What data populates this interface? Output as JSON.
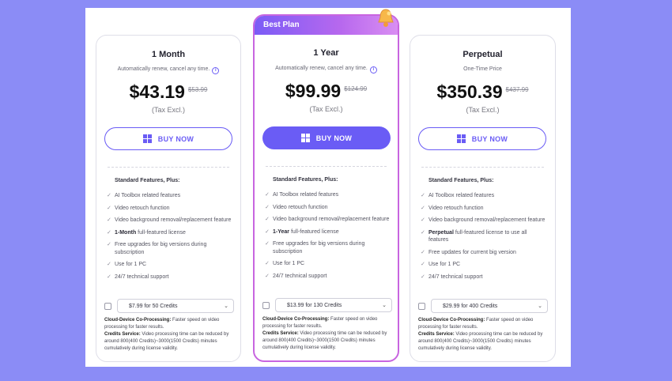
{
  "colors": {
    "background": "#8b8cf6",
    "accent": "#6a5cf5",
    "best_gradient_end": "#d98ef2"
  },
  "best_label": "Best Plan",
  "buy_label": "BUY NOW",
  "features_heading": "Standard Features, Plus:",
  "plans": [
    {
      "title": "1 Month",
      "subtitle": "Automatically renew, cancel any time.",
      "price": "$43.19",
      "old_price": "$53.99",
      "tax": "(Tax Excl.)",
      "features": [
        {
          "bold": "",
          "text": "AI Toolbox related features"
        },
        {
          "bold": "",
          "text": "Video retouch function"
        },
        {
          "bold": "",
          "text": "Video background removal/replacement feature"
        },
        {
          "bold": "1-Month",
          "text": " full-featured license"
        },
        {
          "bold": "",
          "text": "Free upgrades for big versions during subscription"
        },
        {
          "bold": "",
          "text": "Use for 1 PC"
        },
        {
          "bold": "",
          "text": "24/7 technical support"
        }
      ],
      "credit_option": "$7.99 for 50 Credits",
      "cloud_label": "Cloud-Device Co-Processing:",
      "cloud_text": " Faster speed on video processing for faster results.",
      "credits_label": "Credits Service:",
      "credits_text": " Video processing time can be reduced by around 800(400 Credits)~3000(1500 Credits) minutes cumulatively during license validity."
    },
    {
      "title": "1 Year",
      "subtitle": "Automatically renew, cancel any time.",
      "price": "$99.99",
      "old_price": "$124.99",
      "tax": "(Tax Excl.)",
      "features": [
        {
          "bold": "",
          "text": "AI Toolbox related features"
        },
        {
          "bold": "",
          "text": "Video retouch function"
        },
        {
          "bold": "",
          "text": "Video background removal/replacement feature"
        },
        {
          "bold": "1-Year",
          "text": " full-featured license"
        },
        {
          "bold": "",
          "text": "Free upgrades for big versions during subscription"
        },
        {
          "bold": "",
          "text": "Use for 1 PC"
        },
        {
          "bold": "",
          "text": "24/7 technical support"
        }
      ],
      "credit_option": "$13.99 for 130 Credits",
      "cloud_label": "Cloud-Device Co-Processing:",
      "cloud_text": " Faster speed on video processing for faster results.",
      "credits_label": "Credits Service:",
      "credits_text": " Video processing time can be reduced by around 800(400 Credits)~3000(1500 Credits) minutes cumulatively during license validity."
    },
    {
      "title": "Perpetual",
      "subtitle": "One-Time Price",
      "price": "$350.39",
      "old_price": "$437.99",
      "tax": "(Tax Excl.)",
      "features": [
        {
          "bold": "",
          "text": "AI Toolbox related features"
        },
        {
          "bold": "",
          "text": "Video retouch function"
        },
        {
          "bold": "",
          "text": "Video background removal/replacement feature"
        },
        {
          "bold": "Perpetual",
          "text": " full-featured license to use all features"
        },
        {
          "bold": "",
          "text": "Free updates for current big version"
        },
        {
          "bold": "",
          "text": "Use for 1 PC"
        },
        {
          "bold": "",
          "text": "24/7 technical support"
        }
      ],
      "credit_option": "$29.99 for 400 Credits",
      "cloud_label": "Cloud-Device Co-Processing:",
      "cloud_text": " Faster speed on video processing for faster results.",
      "credits_label": "Credits Service:",
      "credits_text": " Video processing time can be reduced by around 800(400 Credits)~3000(1500 Credits) minutes cumulatively during license validity."
    }
  ]
}
